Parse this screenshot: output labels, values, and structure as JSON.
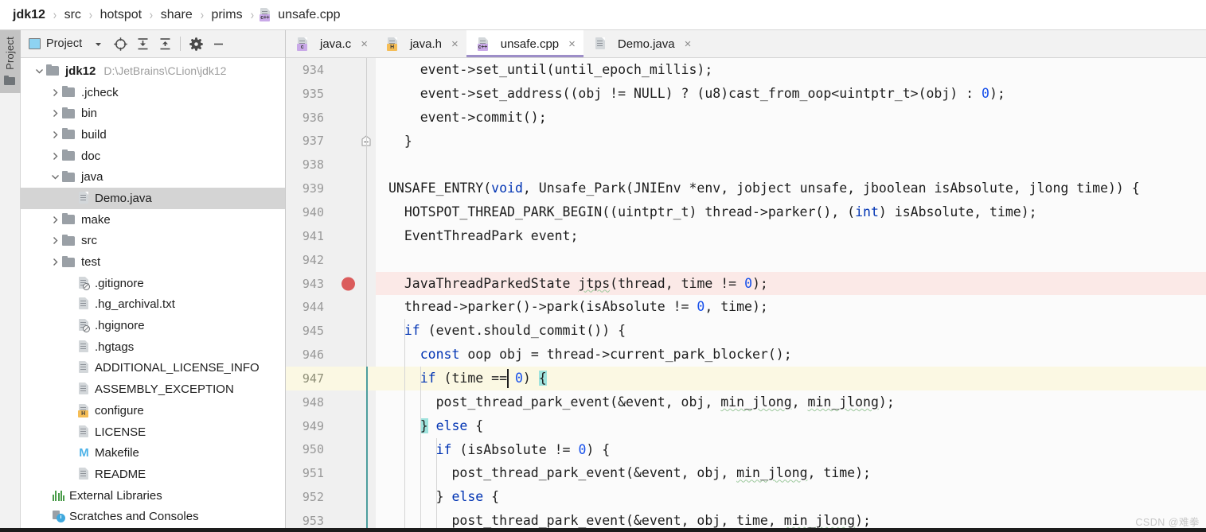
{
  "breadcrumb": {
    "items": [
      {
        "label": "jdk12",
        "icon": null,
        "root": true
      },
      {
        "label": "src",
        "icon": null
      },
      {
        "label": "hotspot",
        "icon": null
      },
      {
        "label": "share",
        "icon": null
      },
      {
        "label": "prims",
        "icon": null
      },
      {
        "label": "unsafe.cpp",
        "icon": "cpp-file-icon",
        "badge": "c++"
      }
    ],
    "separator": "›"
  },
  "tool_strip": {
    "vertical_tab_label": "Project",
    "vertical_tab_icon": "folder-icon"
  },
  "project_panel": {
    "toolbar": {
      "title": "Project",
      "title_icon": "project-view-icon",
      "dropdown_icon": "chevron-down-icon",
      "locate_icon": "target-scroll-from-source-icon",
      "expand_icon": "expand-all-icon",
      "collapse_icon": "collapse-all-icon",
      "settings_icon": "gear-icon",
      "hide_icon": "minimize-icon"
    },
    "tree": [
      {
        "label": "jdk12",
        "path": "D:\\JetBrains\\CLion\\jdk12",
        "indent": 0,
        "twisty": "down",
        "icon": "folder-icon",
        "bold": true,
        "selected": false
      },
      {
        "label": ".jcheck",
        "indent": 1,
        "twisty": "right",
        "icon": "folder-icon",
        "selected": false
      },
      {
        "label": "bin",
        "indent": 1,
        "twisty": "right",
        "icon": "folder-icon",
        "selected": false
      },
      {
        "label": "build",
        "indent": 1,
        "twisty": "right",
        "icon": "folder-icon",
        "selected": false
      },
      {
        "label": "doc",
        "indent": 1,
        "twisty": "right",
        "icon": "folder-icon",
        "selected": false
      },
      {
        "label": "java",
        "indent": 1,
        "twisty": "down",
        "icon": "folder-icon",
        "selected": false
      },
      {
        "label": "Demo.java",
        "indent": 2,
        "twisty": "none",
        "icon": "java-file-icon",
        "selected": true
      },
      {
        "label": "make",
        "indent": 1,
        "twisty": "right",
        "icon": "folder-icon",
        "selected": false
      },
      {
        "label": "src",
        "indent": 1,
        "twisty": "right",
        "icon": "folder-icon",
        "selected": false
      },
      {
        "label": "test",
        "indent": 1,
        "twisty": "right",
        "icon": "folder-icon",
        "selected": false
      },
      {
        "label": ".gitignore",
        "indent": 2,
        "twisty": "none",
        "icon": "ignore-file-icon",
        "selected": false
      },
      {
        "label": ".hg_archival.txt",
        "indent": 2,
        "twisty": "none",
        "icon": "text-file-icon",
        "selected": false
      },
      {
        "label": ".hgignore",
        "indent": 2,
        "twisty": "none",
        "icon": "ignore-file-icon",
        "selected": false
      },
      {
        "label": ".hgtags",
        "indent": 2,
        "twisty": "none",
        "icon": "text-file-icon",
        "selected": false
      },
      {
        "label": "ADDITIONAL_LICENSE_INFO",
        "indent": 2,
        "twisty": "none",
        "icon": "text-file-icon",
        "selected": false
      },
      {
        "label": "ASSEMBLY_EXCEPTION",
        "indent": 2,
        "twisty": "none",
        "icon": "text-file-icon",
        "selected": false
      },
      {
        "label": "configure",
        "indent": 2,
        "twisty": "none",
        "icon": "h-file-icon",
        "selected": false
      },
      {
        "label": "LICENSE",
        "indent": 2,
        "twisty": "none",
        "icon": "text-file-icon",
        "selected": false
      },
      {
        "label": "Makefile",
        "indent": 2,
        "twisty": "none",
        "icon": "makefile-icon",
        "selected": false
      },
      {
        "label": "README",
        "indent": 2,
        "twisty": "none",
        "icon": "text-file-icon",
        "selected": false
      },
      {
        "label": "External Libraries",
        "indent": 0.4,
        "twisty": "none",
        "icon": "external-libraries-icon",
        "selected": false
      },
      {
        "label": "Scratches and Consoles",
        "indent": 0.4,
        "twisty": "none",
        "icon": "scratches-icon",
        "selected": false
      }
    ]
  },
  "editor": {
    "tabs": [
      {
        "label": "java.c",
        "icon": "c-file-icon",
        "badge": "c",
        "active": false
      },
      {
        "label": "java.h",
        "icon": "h-file-icon",
        "badge": "H",
        "active": false
      },
      {
        "label": "unsafe.cpp",
        "icon": "cpp-file-icon",
        "badge": "c++",
        "active": true
      },
      {
        "label": "Demo.java",
        "icon": "java-file-icon",
        "badge": "",
        "active": false
      }
    ],
    "close_glyph": "×",
    "active_tab_underline_color": "#9d8ec8",
    "breakpoint_color": "#db5c5c",
    "breakpoint_line": 943,
    "caret_line": 947,
    "lines": [
      {
        "n": 934,
        "text": "    event->set_until(until_epoch_millis);"
      },
      {
        "n": 935,
        "text": "    event->set_address((obj != NULL) ? (u8)cast_from_oop<uintptr_t>(obj) : 0);"
      },
      {
        "n": 936,
        "text": "    event->commit();"
      },
      {
        "n": 937,
        "text": "  }"
      },
      {
        "n": 938,
        "text": ""
      },
      {
        "n": 939,
        "text": "UNSAFE_ENTRY(void, Unsafe_Park(JNIEnv *env, jobject unsafe, jboolean isAbsolute, jlong time)) {"
      },
      {
        "n": 940,
        "text": "  HOTSPOT_THREAD_PARK_BEGIN((uintptr_t) thread->parker(), (int) isAbsolute, time);"
      },
      {
        "n": 941,
        "text": "  EventThreadPark event;"
      },
      {
        "n": 942,
        "text": ""
      },
      {
        "n": 943,
        "text": "  JavaThreadParkedState jtps(thread, time != 0);"
      },
      {
        "n": 944,
        "text": "  thread->parker()->park(isAbsolute != 0, time);"
      },
      {
        "n": 945,
        "text": "  if (event.should_commit()) {"
      },
      {
        "n": 946,
        "text": "    const oop obj = thread->current_park_blocker();"
      },
      {
        "n": 947,
        "text": "    if (time == 0) {"
      },
      {
        "n": 948,
        "text": "      post_thread_park_event(&event, obj, min_jlong, min_jlong);"
      },
      {
        "n": 949,
        "text": "    } else {"
      },
      {
        "n": 950,
        "text": "      if (isAbsolute != 0) {"
      },
      {
        "n": 951,
        "text": "        post_thread_park_event(&event, obj, min_jlong, time);"
      },
      {
        "n": 952,
        "text": "      } else {"
      },
      {
        "n": 953,
        "text": "        post_thread_park_event(&event, obj, time, min_jlong);"
      }
    ]
  },
  "watermark": {
    "text": "CSDN @难拳"
  }
}
